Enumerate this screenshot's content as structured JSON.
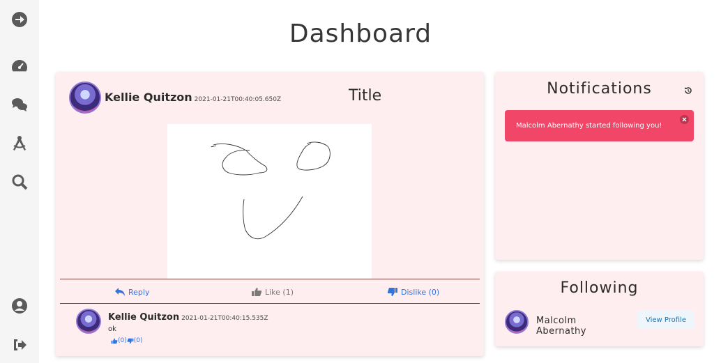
{
  "page": {
    "title": "Dashboard"
  },
  "sidebar": {
    "items": [
      {
        "icon": "arrow-circle-right-icon"
      },
      {
        "icon": "tachometer-icon"
      },
      {
        "icon": "comments-icon"
      },
      {
        "icon": "drafting-compass-icon"
      },
      {
        "icon": "search-icon"
      },
      {
        "icon": "user-circle-icon"
      },
      {
        "icon": "sign-out-icon"
      }
    ]
  },
  "post": {
    "author": "Kellie Quitzon",
    "timestamp": "2021-01-21T00:40:05.650Z",
    "title": "Title",
    "actions": {
      "reply": "Reply",
      "like": "Like (1)",
      "dislike": "Dislike (0)"
    },
    "comment": {
      "author": "Kellie Quitzon",
      "timestamp": "2021-01-21T00:40:15.535Z",
      "text": "ok",
      "likes": "(0)",
      "dislikes": "(0)"
    }
  },
  "notifications": {
    "heading": "Notifications",
    "items": [
      {
        "text": "Malcolm Abernathy started following you!"
      }
    ]
  },
  "following": {
    "heading": "Following",
    "items": [
      {
        "name": "Malcolm Abernathy",
        "button": "View Profile"
      }
    ]
  },
  "colors": {
    "accent": "#3273dc",
    "notification": "#f14668",
    "card_bg": "#ffeef0"
  }
}
